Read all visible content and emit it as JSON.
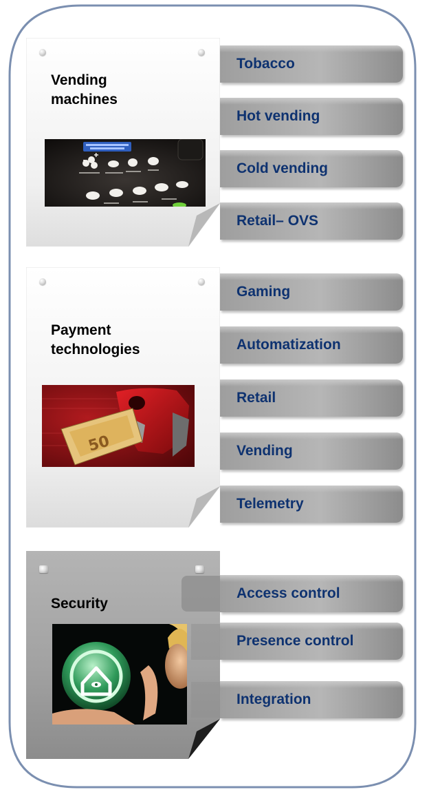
{
  "colors": {
    "frame_border": "#7b8fb0",
    "tab_text": "#0e3270",
    "tab_fill": "#a8a8a8",
    "card_paper": "#ececec",
    "card_paper_dark": "#9a9a9a"
  },
  "categories": [
    {
      "title": "Vending machines",
      "image": "coffee-vending-machine-panel",
      "items": [
        "Tobacco",
        "Hot vending",
        "Cold vending",
        "Retail– OVS"
      ]
    },
    {
      "title": "Payment technologies",
      "image": "banknote-acceptor-with-50-euro-note",
      "items": [
        "Gaming",
        "Automatization",
        "Retail",
        "Vending",
        "Telemetry"
      ]
    },
    {
      "title": "Security",
      "image": "woman-holding-glowing-home-security-orb",
      "items": [
        "Access control",
        "Presence control",
        "Integration"
      ]
    }
  ]
}
